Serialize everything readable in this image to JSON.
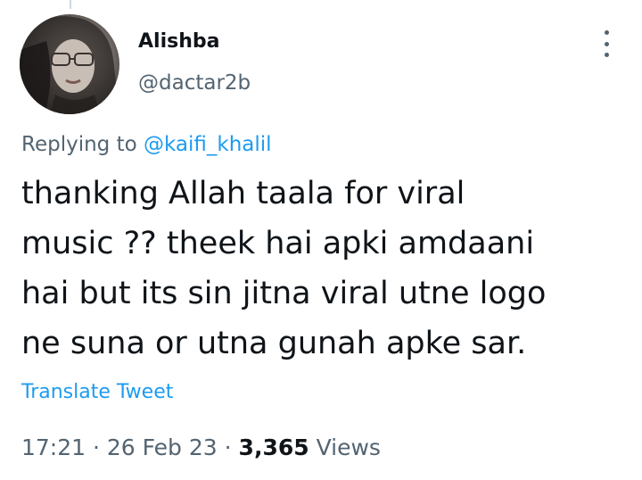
{
  "tweet": {
    "author": {
      "display_name": "Alishba",
      "handle": "@dactar2b"
    },
    "replying_prefix": "Replying to",
    "replying_to": "@kaifi_khalil",
    "text_lines": [
      "thanking Allah taala for viral",
      "music ?? theek hai apki amdaani",
      "hai but its sin jitna viral utne logo",
      "ne suna or utna gunah apke sar."
    ],
    "translate_label": "Translate Tweet",
    "time": "17:21",
    "separator": "·",
    "date": "26 Feb 23",
    "views_count": "3,365",
    "views_label": "Views"
  },
  "icons": {
    "more": "more-vertical-icon"
  },
  "colors": {
    "accent": "#1d9bf0",
    "text_primary": "#0f1419",
    "text_secondary": "#536471"
  }
}
